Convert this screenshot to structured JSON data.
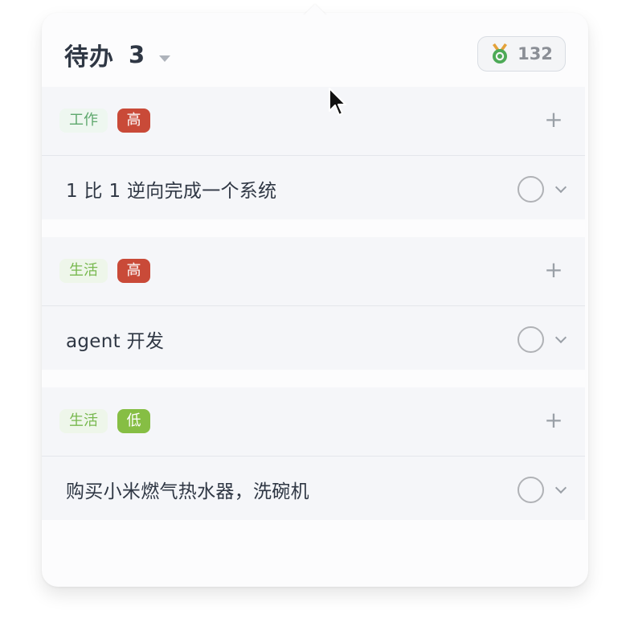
{
  "header": {
    "title": "待办",
    "count": "3",
    "score": "132"
  },
  "groups": [
    {
      "category": "工作",
      "priority": "高",
      "task": "1 比 1 逆向完成一个系统"
    },
    {
      "category": "生活",
      "priority": "高",
      "task": "agent 开发"
    },
    {
      "category": "生活",
      "priority": "低",
      "task": "购买小米燃气热水器，洗碗机"
    }
  ],
  "icons": {
    "add": "plus-icon",
    "complete": "circle-check-icon",
    "expand": "chevron-down-icon",
    "medal": "medal-icon",
    "dropdown": "caret-down-icon"
  },
  "colors": {
    "work_tag_text": "#5ea86d",
    "life_tag_text": "#78b84f",
    "priority_high": "#c94a38",
    "priority_low": "#86be44",
    "title_text": "#2f3744"
  }
}
